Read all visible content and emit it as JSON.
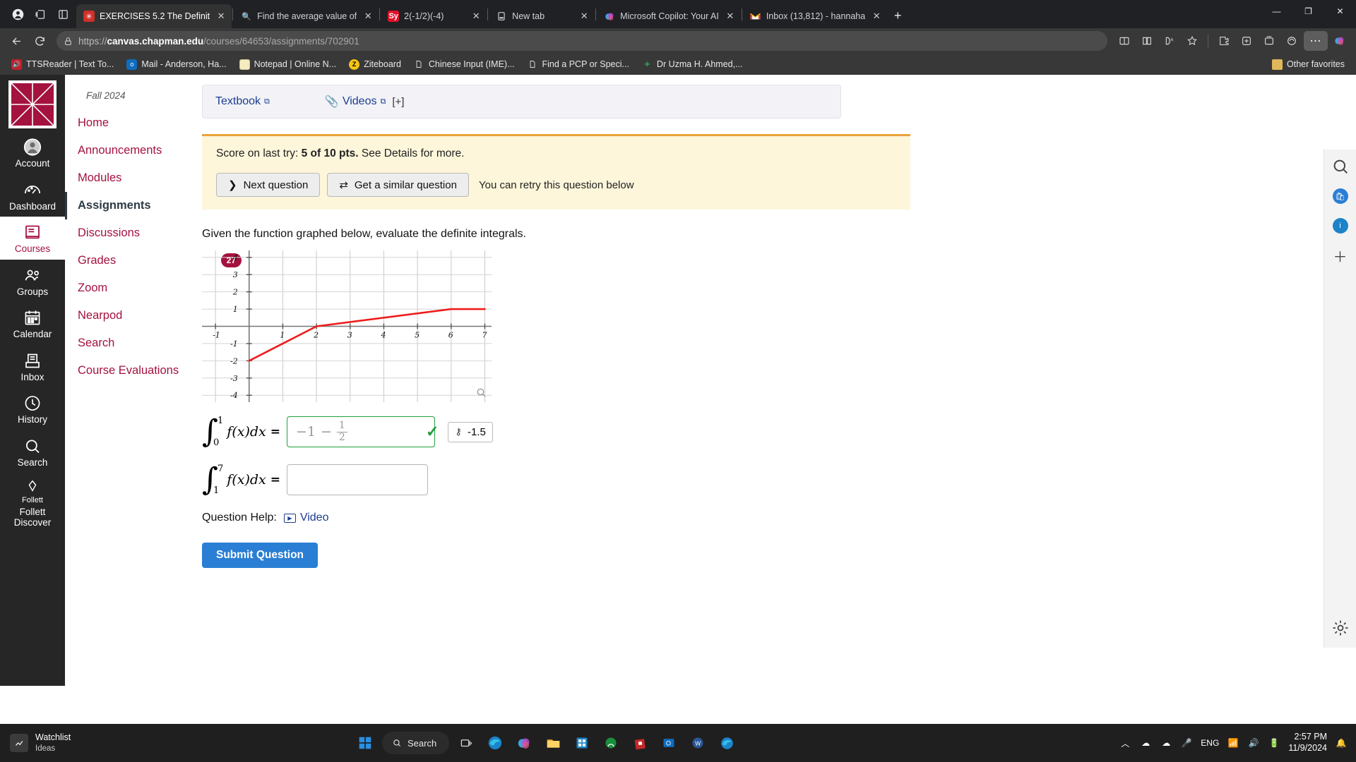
{
  "browser": {
    "tabs": [
      {
        "title": "EXERCISES 5.2 The Definit",
        "icon": "canvas-icon",
        "active": true
      },
      {
        "title": "Find the average value of",
        "icon": "search-icon",
        "active": false
      },
      {
        "title": "2(-1/2)(-4)",
        "icon": "symbolab-icon",
        "active": false
      },
      {
        "title": "New tab",
        "icon": "newtab-icon",
        "active": false
      },
      {
        "title": "Microsoft Copilot: Your AI",
        "icon": "copilot-icon",
        "active": false
      },
      {
        "title": "Inbox (13,812) - hannaha",
        "icon": "gmail-icon",
        "active": false
      }
    ],
    "url": {
      "scheme": "https://",
      "host": "canvas.chapman.edu",
      "path": "/courses/64653/assignments/702901"
    },
    "bookmarks": [
      {
        "label": "TTSReader | Text To...",
        "icon": "speaker-icon"
      },
      {
        "label": "Mail - Anderson, Ha...",
        "icon": "outlook-icon"
      },
      {
        "label": "Notepad | Online N...",
        "icon": "notepad-icon"
      },
      {
        "label": "Ziteboard",
        "icon": "ziteboard-icon"
      },
      {
        "label": "Chinese Input (IME)...",
        "icon": "page-icon"
      },
      {
        "label": "Find a PCP or Speci...",
        "icon": "page-icon"
      },
      {
        "label": "Dr Uzma H. Ahmed,...",
        "icon": "medical-cross-icon"
      }
    ],
    "other_favorites": "Other favorites",
    "window_controls": {
      "minimize": "—",
      "maximize": "❐",
      "close": "✕"
    },
    "new_tab_label": "+"
  },
  "global_nav": {
    "items": [
      {
        "label": "Account",
        "icon": "account-icon",
        "active": false
      },
      {
        "label": "Dashboard",
        "icon": "dashboard-icon",
        "active": false
      },
      {
        "label": "Courses",
        "icon": "courses-icon",
        "active": true
      },
      {
        "label": "Groups",
        "icon": "groups-icon",
        "active": false
      },
      {
        "label": "Calendar",
        "icon": "calendar-icon",
        "active": false
      },
      {
        "label": "Inbox",
        "icon": "inbox-icon",
        "active": false
      },
      {
        "label": "History",
        "icon": "history-icon",
        "active": false
      },
      {
        "label": "Search",
        "icon": "search-icon",
        "active": false
      },
      {
        "label": "Follett Discover",
        "icon": "follett-icon",
        "active": false
      }
    ]
  },
  "course_nav": {
    "term": "Fall 2024",
    "items": [
      {
        "label": "Home",
        "active": false,
        "badge": null
      },
      {
        "label": "Announcements",
        "active": false,
        "badge": null
      },
      {
        "label": "Modules",
        "active": false,
        "badge": null
      },
      {
        "label": "Assignments",
        "active": true,
        "badge": null
      },
      {
        "label": "Discussions",
        "active": false,
        "badge": null
      },
      {
        "label": "Grades",
        "active": false,
        "badge": "27"
      },
      {
        "label": "Zoom",
        "active": false,
        "badge": null
      },
      {
        "label": "Nearpod",
        "active": false,
        "badge": null
      },
      {
        "label": "Search",
        "active": false,
        "badge": null
      },
      {
        "label": "Course Evaluations",
        "active": false,
        "badge": null
      }
    ]
  },
  "resources": {
    "textbook": "Textbook",
    "videos": "Videos",
    "expand": "[+]"
  },
  "banner": {
    "score_prefix": "Score on last try:",
    "score_value": "5 of 10 pts.",
    "score_suffix": "See Details for more.",
    "next_question": "Next question",
    "similar_question": "Get a similar question",
    "retry_note": "You can retry this question below"
  },
  "question": {
    "prompt": "Given the function graphed below, evaluate the definite integrals.",
    "answers": [
      {
        "lower": "0",
        "upper": "1",
        "integrand": "f(x)dx",
        "equals": "=",
        "value_whole": "−1",
        "value_minus": "−",
        "value_num": "1",
        "value_den": "2",
        "correct": true,
        "score_key": "⚷",
        "score_value": "-1.5"
      },
      {
        "lower": "1",
        "upper": "7",
        "integrand": "f(x)dx",
        "equals": "=",
        "value_whole": "",
        "correct": false
      }
    ],
    "help_label": "Question Help:",
    "help_video": "Video",
    "submit": "Submit Question"
  },
  "chart_data": {
    "type": "line",
    "title": "",
    "xlabel": "",
    "ylabel": "",
    "xlim": [
      -1.4,
      7.2
    ],
    "ylim": [
      -4.4,
      4.4
    ],
    "xticks": [
      -1,
      1,
      2,
      3,
      4,
      5,
      6,
      7
    ],
    "yticks": [
      4,
      3,
      2,
      1,
      -1,
      -2,
      -3,
      -4
    ],
    "grid": true,
    "series": [
      {
        "name": "f(x)",
        "color": "#ee1c1c",
        "x": [
          0,
          2,
          6,
          7
        ],
        "y": [
          -2,
          0,
          1,
          1
        ]
      }
    ]
  },
  "taskbar": {
    "widget_title": "Watchlist",
    "widget_sub": "Ideas",
    "search_label": "Search",
    "language": "ENG",
    "time": "2:57 PM",
    "date": "11/9/2024",
    "apps": [
      "start-icon",
      "search-button",
      "task-view-icon",
      "edge-icon",
      "copilot-icon",
      "file-explorer-icon",
      "store-icon",
      "xbox-icon",
      "roblox-icon",
      "outlook-icon",
      "word-icon",
      "edge2-icon"
    ]
  }
}
